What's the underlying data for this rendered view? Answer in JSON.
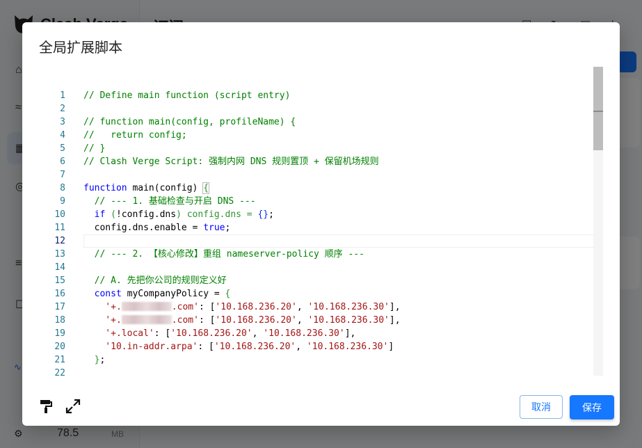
{
  "app": {
    "logo_text": "Clash Verge",
    "page_title": "订阅",
    "memory_value": "78.5",
    "memory_unit": "MB"
  },
  "dialog": {
    "title": "全局扩展脚本",
    "cancel_label": "取消",
    "save_label": "保存"
  },
  "editor": {
    "current_line": 12,
    "line_numbers": [
      "1",
      "2",
      "3",
      "4",
      "5",
      "6",
      "7",
      "8",
      "9",
      "10",
      "11",
      "12",
      "13",
      "14",
      "15",
      "16",
      "17",
      "18",
      "19",
      "20",
      "21",
      "22"
    ],
    "lines": {
      "l1": "// Define main function (script entry)",
      "l3": "// function main(config, profileName) {",
      "l4": "//   return config;",
      "l5": "// }",
      "l6": "// Clash Verge Script: 强制内网 DNS 规则置顶 + 保留机场规则",
      "l8_kw": "function",
      "l8_rest": " main(config) ",
      "l8_brace": "{",
      "l9": "  // --- 1. 基础检查与开启 DNS ---",
      "l10_kw": "if",
      "l10_a": " (",
      "l10_b": "!config.dns",
      "l10_c": ") config.dns = ",
      "l10_d": "{}",
      "l10_e": ";",
      "l11_a": "  config.dns.enable = ",
      "l11_kw": "true",
      "l11_b": ";",
      "l13": "  // --- 2. 【核心修改】重组 nameserver-policy 顺序 ---",
      "l15": "  // A. 先把你公司的规则定义好",
      "l16_kw": "const",
      "l16_rest": " myCompanyPolicy = ",
      "l16_brace": "{",
      "l17_a": "    '+.",
      "l17_b": ".com'",
      "l17_c": ": [",
      "l17_d": "'10.168.236.20'",
      "l17_e": ", ",
      "l17_f": "'10.168.236.30'",
      "l17_g": "],",
      "l18_a": "    '+.",
      "l18_b": ".com'",
      "l18_c": ": [",
      "l18_d": "'10.168.236.20'",
      "l18_e": ", ",
      "l18_f": "'10.168.236.30'",
      "l18_g": "],",
      "l19_a": "    '+.local'",
      "l19_c": ": [",
      "l19_d": "'10.168.236.20'",
      "l19_e": ", ",
      "l19_f": "'10.168.236.30'",
      "l19_g": "],",
      "l20_a": "    '10.in-addr.arpa'",
      "l20_c": ": [",
      "l20_d": "'10.168.236.20'",
      "l20_e": ", ",
      "l20_f": "'10.168.236.30'",
      "l20_g": "]",
      "l21_brace": "}",
      "l21_b": ";"
    }
  },
  "icons": {
    "format": "paint-roller-icon",
    "fullscreen": "expand-icon"
  },
  "colors": {
    "primary": "#1677ff",
    "comment": "#008000",
    "keyword": "#0000ff",
    "string": "#a31515",
    "line_number": "#237893"
  }
}
